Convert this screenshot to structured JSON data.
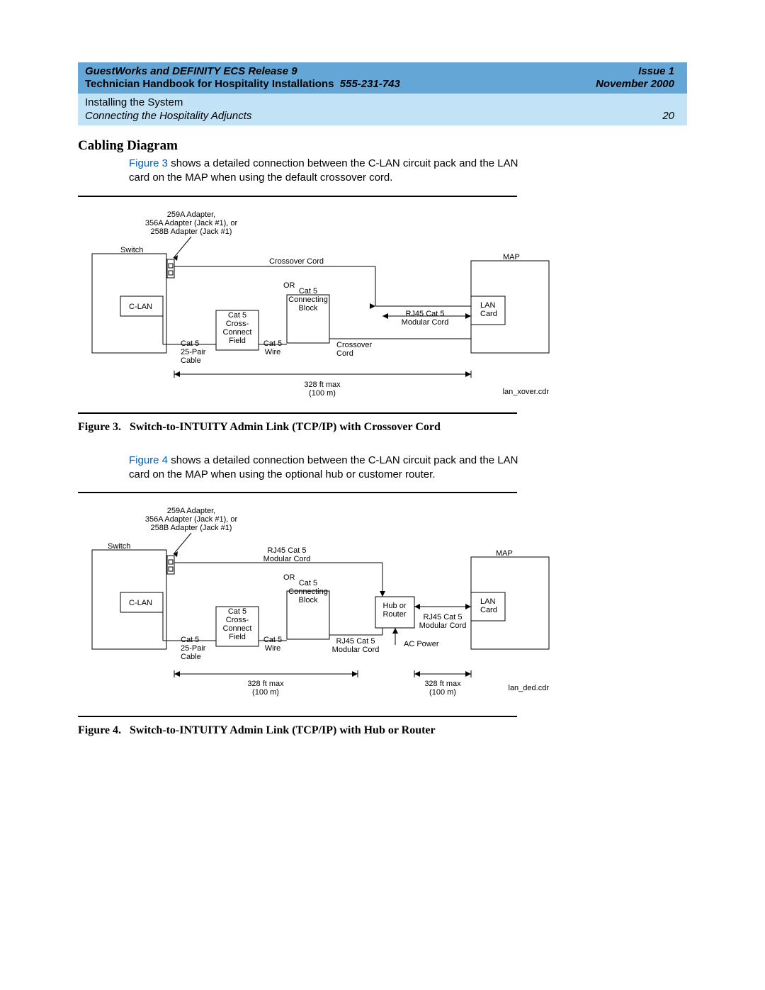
{
  "header": {
    "product_line": "GuestWorks and DEFINITY ECS Release 9",
    "issue": "Issue 1",
    "subtitle": "Technician Handbook for Hospitality Installations",
    "doc_number": "555-231-743",
    "date": "November 2000",
    "chapter": "Installing the System",
    "section_path": "Connecting the Hospitality Adjuncts",
    "page_number": "20"
  },
  "section_title": "Cabling Diagram",
  "para1": {
    "fig_ref": "Figure 3",
    "rest": " shows a detailed connection between the C-LAN circuit pack and the LAN card on the MAP when using the default crossover cord."
  },
  "para2": {
    "fig_ref": "Figure 4",
    "rest": " shows a detailed connection between the C-LAN circuit pack and the LAN card on the MAP when using the optional hub or customer router."
  },
  "fig3": {
    "caption_prefix": "Figure 3.",
    "caption_title": "Switch-to-INTUITY Admin Link (TCP/IP) with Crossover Cord",
    "adapter_line1": "259A Adapter,",
    "adapter_line2": "356A  Adapter (Jack #1), or",
    "adapter_line3": "258B Adapter (Jack #1)",
    "switch": "Switch",
    "clan": "C-LAN",
    "crossover_cord": "Crossover Cord",
    "or": "OR",
    "cat5_block1": "Cat 5",
    "cat5_block2": "Connecting",
    "cat5_block3": "Block",
    "cross_conn1": "Cat 5",
    "cross_conn2": "Cross-",
    "cross_conn3": "Connect",
    "cross_conn4": "Field",
    "cat5_wire1": "Cat 5",
    "cat5_wire2": "Wire",
    "crossover1": "Crossover",
    "crossover2": "Cord",
    "cable1": "Cat 5",
    "cable2": "25-Pair",
    "cable3": "Cable",
    "rj45_1": "RJ45 Cat 5",
    "rj45_2": "Modular Cord",
    "map": "MAP",
    "lan1": "LAN",
    "lan2": "Card",
    "dist1": "328 ft max",
    "dist2": "(100 m)",
    "file": "lan_xover.cdr"
  },
  "fig4": {
    "caption_prefix": "Figure 4.",
    "caption_title": "Switch-to-INTUITY Admin Link (TCP/IP) with Hub or Router",
    "adapter_line1": "259A Adapter,",
    "adapter_line2": "356A Adapter (Jack #1), or",
    "adapter_line3": "258B Adapter (Jack #1)",
    "switch": "Switch",
    "clan": "C-LAN",
    "modcord1": "RJ45 Cat 5",
    "modcord2": "Modular Cord",
    "or": "OR",
    "cat5_block1": "Cat 5",
    "cat5_block2": "Connecting",
    "cat5_block3": "Block",
    "cross_conn1": "Cat 5",
    "cross_conn2": "Cross-",
    "cross_conn3": "Connect",
    "cross_conn4": "Field",
    "cat5_wire1": "Cat 5",
    "cat5_wire2": "Wire",
    "modcord_b1": "RJ45 Cat 5",
    "modcord_b2": "Modular Cord",
    "cable1": "Cat 5",
    "cable2": "25-Pair",
    "cable3": "Cable",
    "hub1": "Hub or",
    "hub2": "Router",
    "acpower": "AC Power",
    "rj45_1": "RJ45 Cat 5",
    "rj45_2": "Modular Cord",
    "map": "MAP",
    "lan1": "LAN",
    "lan2": "Card",
    "dist1": "328 ft max",
    "dist2": "(100 m)",
    "dist1b": "328 ft max",
    "dist2b": "(100 m)",
    "file": "lan_ded.cdr"
  }
}
